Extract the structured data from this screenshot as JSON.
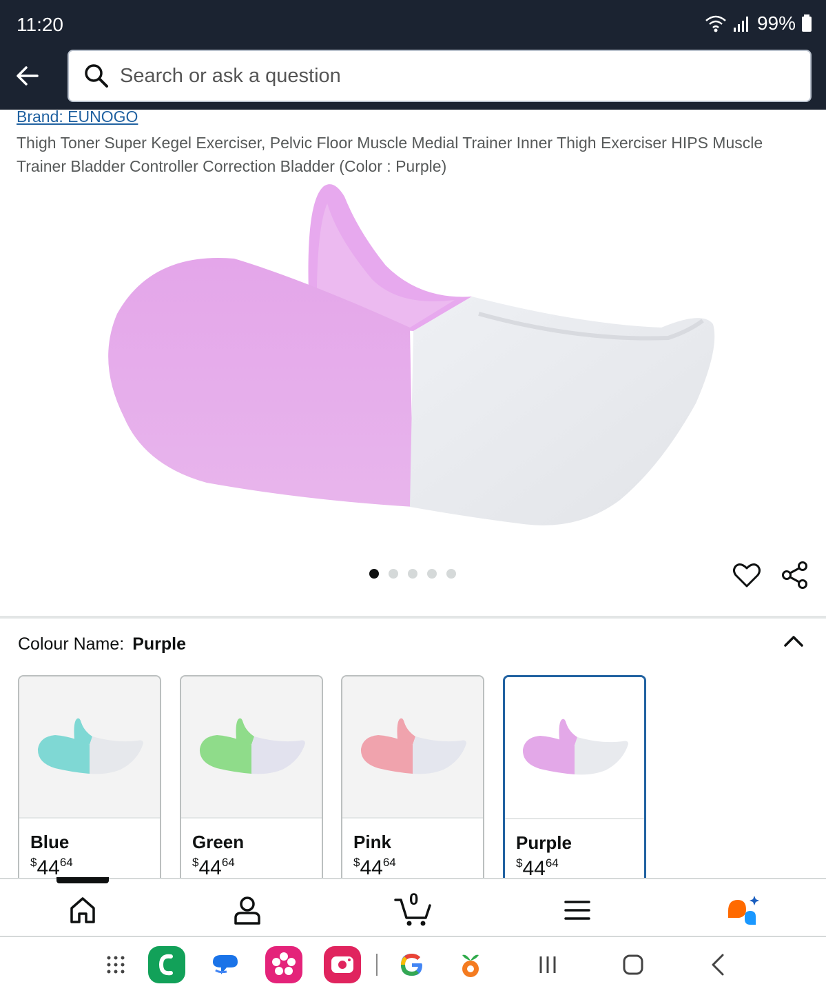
{
  "status": {
    "time": "11:20",
    "battery": "99%"
  },
  "search": {
    "placeholder": "Search or ask a question"
  },
  "product": {
    "brand": "Brand: EUNOGO",
    "title": "Thigh Toner Super Kegel Exerciser, Pelvic Floor Muscle Medial Trainer Inner Thigh Exerciser HIPS Muscle Trainer Bladder Controller Correction Bladder (Color : Purple)",
    "image_count": 5,
    "active_image": 1
  },
  "variation": {
    "label": "Colour Name:",
    "selected": "Purple",
    "options": [
      {
        "name": "Blue",
        "currency": "$",
        "price_whole": "44",
        "price_cents": "64",
        "color": "#7fd8d4"
      },
      {
        "name": "Green",
        "currency": "$",
        "price_whole": "44",
        "price_cents": "64",
        "color": "#8fdc8a"
      },
      {
        "name": "Pink",
        "currency": "$",
        "price_whole": "44",
        "price_cents": "64",
        "color": "#f0a3ad"
      },
      {
        "name": "Purple",
        "currency": "$",
        "price_whole": "44",
        "price_cents": "64",
        "color": "#e3a8e8"
      }
    ]
  },
  "bottom_nav": {
    "items": [
      "home-icon",
      "account-icon",
      "cart-icon",
      "menu-icon",
      "rufus-icon"
    ],
    "cart_count": "0"
  },
  "colors": {
    "header_bg": "#1b2331",
    "link": "#2162a1",
    "selected_border": "#2162a1"
  }
}
